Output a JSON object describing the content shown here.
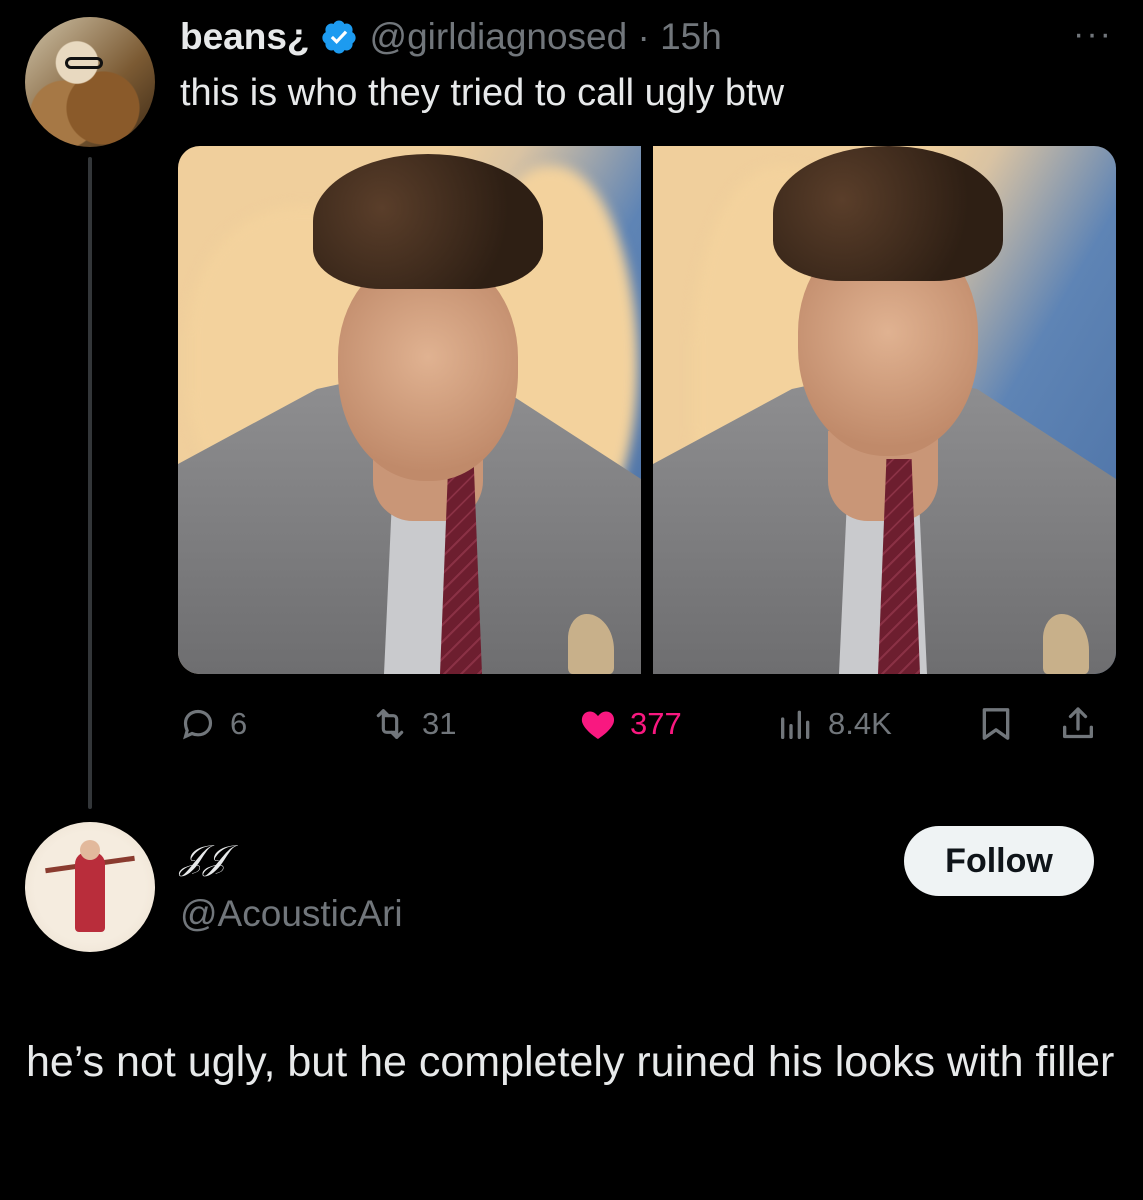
{
  "tweet": {
    "author_name": "beans¿",
    "handle": "@girldiagnosed",
    "timestamp": "15h",
    "text": "this is who they tried to call ugly btw",
    "more_label": "···",
    "stats": {
      "replies": "6",
      "retweets": "31",
      "likes": "377",
      "views": "8.4K"
    },
    "icons": [
      "reply-icon",
      "retweet-icon",
      "like-icon",
      "views-icon",
      "bookmark-icon",
      "share-icon"
    ],
    "colors": {
      "like_active": "#f91880",
      "verified": "#1d9bf0",
      "muted": "#71767b"
    }
  },
  "reply": {
    "author_name": "𝒥𝒥",
    "handle": "@AcousticAri",
    "follow_label": "Follow",
    "text": "he’s not ugly, but he completely ruined his looks with filler"
  }
}
